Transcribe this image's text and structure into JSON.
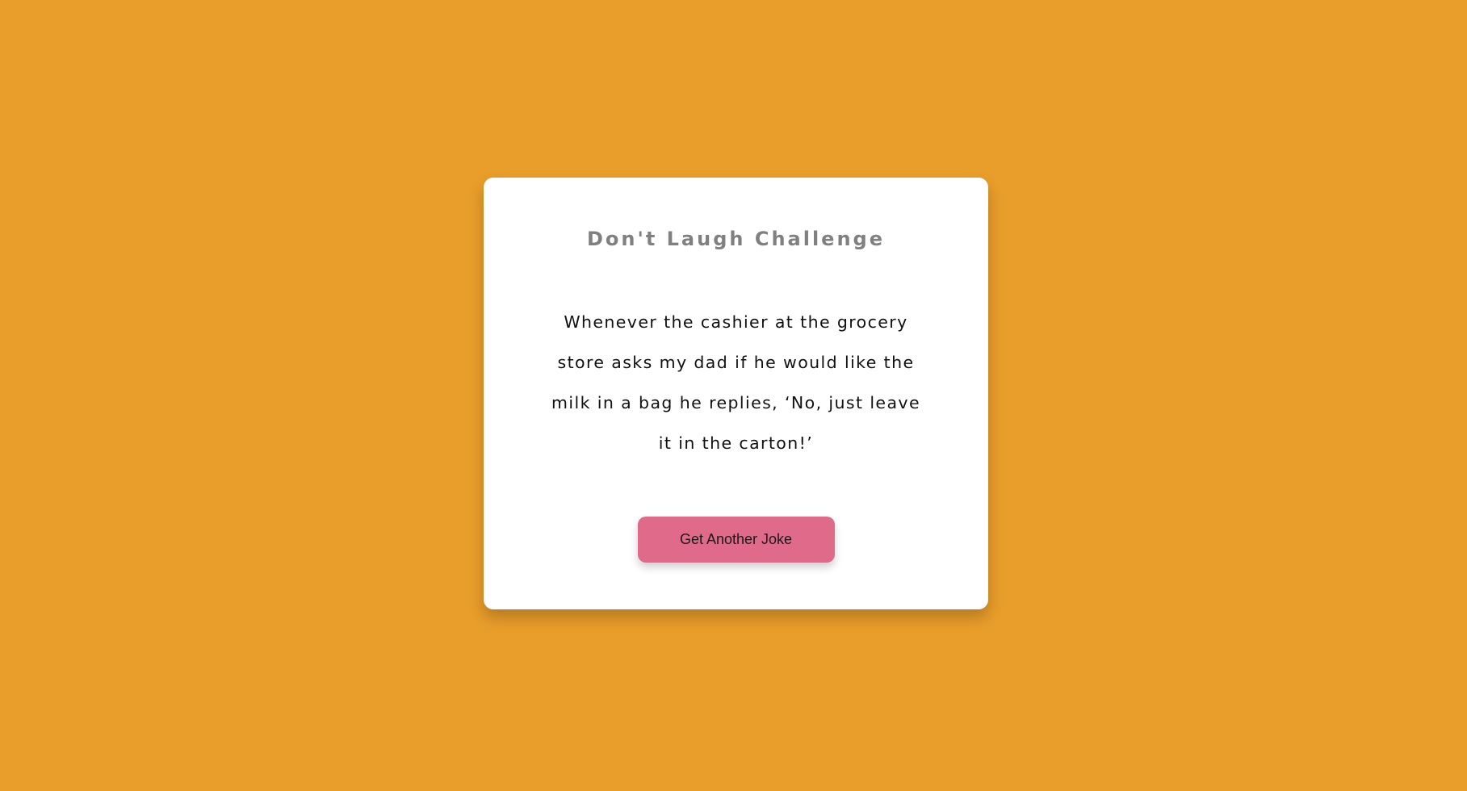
{
  "page": {
    "background_color": "#e99d2a"
  },
  "card": {
    "title": "Don't Laugh Challenge",
    "joke": "Whenever the cashier at the grocery store asks my dad if he would like the milk in a bag he replies, ‘No, just leave it in the carton!’",
    "button_label": "Get Another Joke",
    "button_color": "#e06a8a"
  }
}
